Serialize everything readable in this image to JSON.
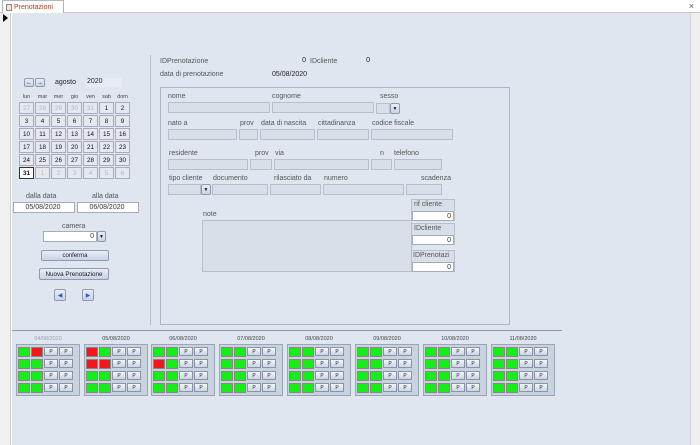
{
  "tab": {
    "title": "Prenotazioni"
  },
  "window": {
    "close_glyph": "×"
  },
  "header": {
    "idprenotazione_label": "IDPrenotazione",
    "idprenotazione_value": "0",
    "idcliente_label": "IDcliente",
    "idcliente_value": "0",
    "data_prenotazione_label": "data di prenotazione",
    "data_prenotazione_value": "05/08/2020"
  },
  "calendar": {
    "month": "agosto",
    "year": "2020",
    "weekdays": [
      "lun",
      "mar",
      "mer",
      "gio",
      "ven",
      "sab",
      "dom"
    ],
    "weeks": [
      [
        "27",
        "28",
        "29",
        "30",
        "31",
        "1",
        "2"
      ],
      [
        "3",
        "4",
        "5",
        "6",
        "7",
        "8",
        "9"
      ],
      [
        "10",
        "11",
        "12",
        "13",
        "14",
        "15",
        "16"
      ],
      [
        "17",
        "18",
        "19",
        "20",
        "21",
        "22",
        "23"
      ],
      [
        "24",
        "25",
        "26",
        "27",
        "28",
        "29",
        "30"
      ],
      [
        "31",
        "1",
        "2",
        "3",
        "4",
        "5",
        "6"
      ]
    ]
  },
  "range": {
    "from_label": "dalla data",
    "from_value": "05/08/2020",
    "to_label": "alla data",
    "to_value": "06/08/2020",
    "camera_label": "camera",
    "camera_value": "0",
    "confirm_label": "conferma",
    "new_label": "Nuova Prenotazione",
    "prev_glyph": "◀",
    "next_glyph": "▶"
  },
  "client": {
    "nome": "nome",
    "cognome": "cognome",
    "sesso": "sesso",
    "nato_a": "nato a",
    "prov": "prov",
    "data_nascita": "data di nascita",
    "cittadinanza": "cittadinanza",
    "codice_fiscale": "codice fiscale",
    "residente": "residente",
    "prov2": "prov",
    "via": "via",
    "n": "n",
    "telefono": "telefono",
    "tipo_cliente": "tipo cliente",
    "documento": "documento",
    "rilasciato_da": "rilasciato da",
    "numero": "numero",
    "scadenza": "scadenza",
    "note": "note",
    "rif_cliente_label": "rif cliente",
    "rif_cliente_value": "0",
    "idcliente_label": "IDcliente",
    "idcliente_value": "0",
    "idprenotazi_label": "IDPrenotazi",
    "idprenotazi_value": "0"
  },
  "days": [
    {
      "date": "04/08/2020",
      "rooms": [
        [
          "g",
          "r"
        ],
        [
          "g",
          "g"
        ],
        [
          "g",
          "g"
        ],
        [
          "g",
          "g"
        ]
      ]
    },
    {
      "date": "05/08/2020",
      "rooms": [
        [
          "r",
          "g"
        ],
        [
          "r",
          "r"
        ],
        [
          "g",
          "g"
        ],
        [
          "g",
          "g"
        ]
      ]
    },
    {
      "date": "06/08/2020",
      "rooms": [
        [
          "g",
          "g"
        ],
        [
          "r",
          "g"
        ],
        [
          "g",
          "g"
        ],
        [
          "g",
          "g"
        ]
      ]
    },
    {
      "date": "07/08/2020",
      "rooms": [
        [
          "g",
          "g"
        ],
        [
          "g",
          "g"
        ],
        [
          "g",
          "g"
        ],
        [
          "g",
          "g"
        ]
      ]
    },
    {
      "date": "08/08/2020",
      "rooms": [
        [
          "g",
          "g"
        ],
        [
          "g",
          "g"
        ],
        [
          "g",
          "g"
        ],
        [
          "g",
          "g"
        ]
      ]
    },
    {
      "date": "09/08/2020",
      "rooms": [
        [
          "g",
          "g"
        ],
        [
          "g",
          "g"
        ],
        [
          "g",
          "g"
        ],
        [
          "g",
          "g"
        ]
      ]
    },
    {
      "date": "10/08/2020",
      "rooms": [
        [
          "g",
          "g"
        ],
        [
          "g",
          "g"
        ],
        [
          "g",
          "g"
        ],
        [
          "g",
          "g"
        ]
      ]
    },
    {
      "date": "11/08/2020",
      "rooms": [
        [
          "g",
          "g"
        ],
        [
          "g",
          "g"
        ],
        [
          "g",
          "g"
        ],
        [
          "g",
          "g"
        ]
      ]
    }
  ],
  "room_button_label": "P",
  "colors": {
    "free": "#17ee17",
    "occupied": "#f01818",
    "form_bg": "#dfe6f0"
  }
}
